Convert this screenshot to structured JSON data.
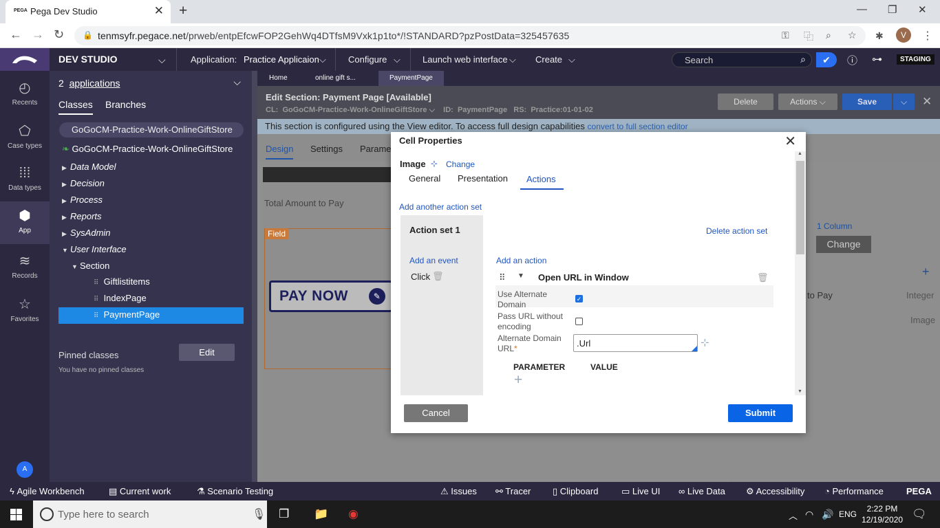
{
  "browser": {
    "tab_favicon": "PEGA",
    "tab_title": "Pega Dev Studio",
    "url_host": "tenmsyfr.pegace.net",
    "url_path": "/prweb/entpEfcwFOP2GehWq4DTfsM9Vxk1p1to*/!STANDARD?pzPostData=325457635",
    "profile_initial": "V",
    "icons": [
      "back-icon",
      "forward-icon",
      "reload-icon",
      "lock-icon",
      "key-icon",
      "translate-icon",
      "zoom-icon",
      "star-icon",
      "extensions-icon"
    ]
  },
  "header": {
    "studio": "DEV STUDIO",
    "application_label": "Application:",
    "application_value": "Practice Applicaion",
    "configure": "Configure",
    "launch": "Launch web interface",
    "create": "Create",
    "search_placeholder": "Search",
    "staging": "STAGING"
  },
  "rail": {
    "items": [
      {
        "label": "Recents",
        "icon": "clock-icon"
      },
      {
        "label": "Case types",
        "icon": "case-icon"
      },
      {
        "label": "Data types",
        "icon": "grid-icon"
      },
      {
        "label": "App",
        "icon": "cube-icon"
      },
      {
        "label": "Records",
        "icon": "layers-icon"
      },
      {
        "label": "Favorites",
        "icon": "star-icon"
      }
    ],
    "avatar": "A"
  },
  "explorer": {
    "apps_count": "2",
    "apps_label": "applications",
    "tab_classes": "Classes",
    "tab_branches": "Branches",
    "class_selector": "GoGoCM-Practice-Work-OnlineGiftStore",
    "root": "GoGoCM-Practice-Work-OnlineGiftStore",
    "categories": [
      "Data Model",
      "Decision",
      "Process",
      "Reports",
      "SysAdmin",
      "User Interface"
    ],
    "section": "Section",
    "sections": [
      "Giftlistitems",
      "IndexPage",
      "PaymentPage"
    ],
    "pinned": "Pinned classes",
    "no_pinned": "You have no pinned classes",
    "edit": "Edit"
  },
  "work": {
    "tabs": [
      "Home",
      "online gift s...",
      "PaymentPage"
    ],
    "edit_title": "Edit  Section: Payment Page [Available]",
    "cl_label": "CL:",
    "cl_value": "GoGoCM-Practice-Work-OnlineGiftStore",
    "id_label": "ID:",
    "id_value": "PaymentPage",
    "rs_label": "RS:",
    "rs_value": "Practice:01-01-02",
    "delete": "Delete",
    "actions": "Actions",
    "save": "Save",
    "info_text": "This section is configured using the View editor. To access full design capabilities",
    "info_link": "convert to full section editor",
    "design_tabs": [
      "Design",
      "Settings",
      "Parame"
    ],
    "total_amount": "Total Amount to Pay",
    "field_label": "Field",
    "pay_now": "PAY NOW",
    "rp_column": "1 Column",
    "rp_change": "Change",
    "rp_row1_name": "to Pay",
    "rp_row1_type": "Integer",
    "rp_row2_type": "Image"
  },
  "modal": {
    "title": "Cell Properties",
    "image_label": "Image",
    "change_link": "Change",
    "tabs": [
      "General",
      "Presentation",
      "Actions"
    ],
    "add_action_set": "Add another action set",
    "action_set": "Action set 1",
    "delete_action_set": "Delete action set",
    "add_event": "Add an event",
    "add_action": "Add an action",
    "event_click": "Click",
    "action_name": "Open URL in Window",
    "use_alt_domain": "Use Alternate Domain",
    "pass_url": "Pass URL without encoding",
    "alt_domain_url": "Alternate Domain URL",
    "alt_domain_value": ".Url",
    "parameter": "PARAMETER",
    "value": "VALUE",
    "cancel": "Cancel",
    "submit": "Submit"
  },
  "statusbar": {
    "left": [
      "Agile Workbench",
      "Current work",
      "Scenario Testing"
    ],
    "right": [
      "Issues",
      "Tracer",
      "Clipboard",
      "Live UI",
      "Live Data",
      "Accessibility",
      "Performance"
    ],
    "brand": "PEGA"
  },
  "taskbar": {
    "search_placeholder": "Type here to search",
    "lang": "ENG",
    "time": "2:22 PM",
    "date": "12/19/2020"
  }
}
